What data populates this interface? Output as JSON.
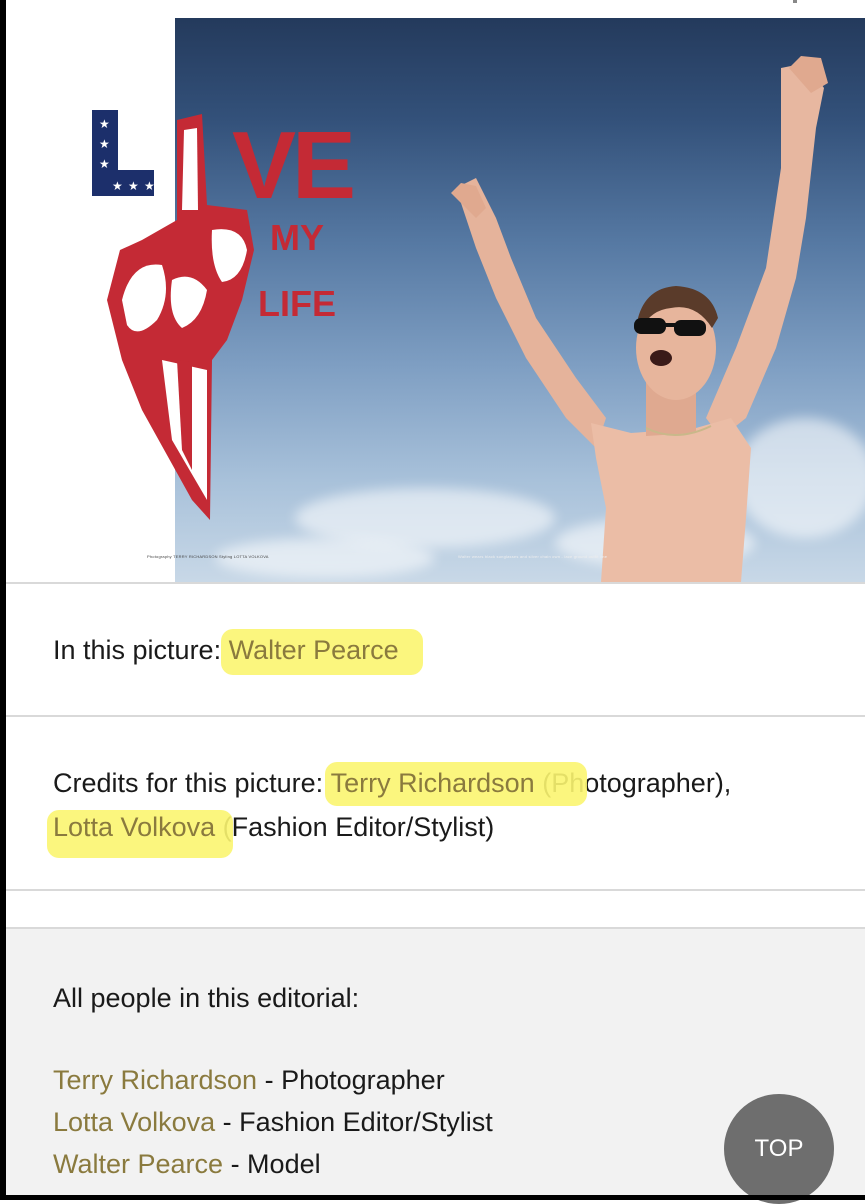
{
  "photo": {
    "logo_words": [
      "LIVE",
      "MY",
      "LIFE"
    ],
    "credit_line_left": "Photography TERRY RICHARDSON Styling LOTTA VOLKOVA",
    "credit_line_right": "Walter wears black sunglasses and silver chain own - lace ground outfit one",
    "colors": {
      "logo_red": "#c42a35",
      "flag_blue": "#1c2f6b",
      "sky_top": "#243a5c",
      "sky_bottom": "#c8d8e7"
    }
  },
  "in_picture": {
    "prefix": "In this picture:",
    "name": "Walter Pearce"
  },
  "credits": {
    "prefix": "Credits for this picture:",
    "photographer_name": "Terry Richardson",
    "photographer_role": "(Photographer),",
    "stylist_name": "Lotta Volkova",
    "stylist_role": "(Fashion Editor/Stylist)"
  },
  "editorial": {
    "heading": "All people in this editorial:",
    "people": [
      {
        "name": "Terry Richardson",
        "role": " - Photographer"
      },
      {
        "name": "Lotta Volkova",
        "role": " - Fashion Editor/Stylist"
      },
      {
        "name": "Walter Pearce",
        "role": " - Model"
      }
    ]
  },
  "top_button": {
    "label": "TOP"
  },
  "colors": {
    "link": "#8a7a3e",
    "highlight": "#fbf570",
    "panel_bg": "#f2f2f2",
    "top_button_bg": "#6e6e6e"
  }
}
